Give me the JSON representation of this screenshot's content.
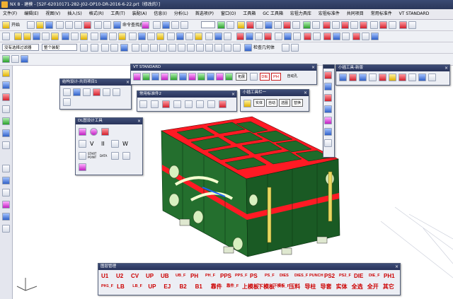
{
  "window": {
    "title": "NX 8 - 建模 - [S2F-62010171-282-J02-OP10-DR-2016-6-22.prt（修改的）]"
  },
  "menu": [
    "文件(F)",
    "编辑(E)",
    "视图(V)",
    "插入(S)",
    "格式(R)",
    "工具(T)",
    "装配(A)",
    "信息(I)",
    "分析(L)",
    "首选项(P)",
    "窗口(O)",
    "工具箱",
    "GC 工具箱",
    "宏祖力具库",
    "宏祖标准件",
    "共同项目",
    "常用标准件",
    "VT STANDARD"
  ],
  "toolbar1": {
    "start_label": "开始",
    "command_finder": "命令查找器"
  },
  "toolbar3": {
    "filter": "没有选择过滤器",
    "assembly_scope": "整个装配"
  },
  "toolbar_r": {
    "label": "检查几何体"
  },
  "panels": {
    "jiegou": {
      "title": "结构设计-共同项目1"
    },
    "vt": {
      "title": "VT STANDARD",
      "buttons": [
        "拓展",
        "DIE",
        "PH",
        "自动孔"
      ]
    },
    "changyong": {
      "title": "常用标准件2"
    },
    "xiaogong1": {
      "title": "小插工具栏一",
      "buttons": [
        "实体",
        "自动",
        "选图",
        "替换"
      ]
    },
    "xiaogong2": {
      "title": "小插工具-新版"
    },
    "dl": {
      "title": "DL图设计工具",
      "row2": [
        "V",
        "II",
        "W"
      ],
      "row3": [
        "START POINT",
        "DATA"
      ]
    },
    "tuceng": {
      "title": "图层管理",
      "row1": [
        "U1",
        "U2",
        "CV",
        "UP",
        "UB",
        "UB_F",
        "PH",
        "PH_F",
        "PPS",
        "PPS_F",
        "PS",
        "PS_F",
        "DIES",
        "DIES_F",
        "PUNCH",
        "PS2",
        "PS2_F",
        "DIE",
        "DIE_F",
        "PH1"
      ],
      "row2": [
        "PH1_F",
        "LB",
        "LB_F",
        "UP",
        "EJ",
        "B2",
        "B1",
        "靠件",
        "靠件_F",
        "上模板",
        "下模板",
        "下模板_F",
        "压料",
        "导柱",
        "导套",
        "实体",
        "全选",
        "全开",
        "其它"
      ]
    }
  },
  "colors": {
    "die_green": "#1f6b2a",
    "die_red": "#ff1a24",
    "title_blue": "#2a375a"
  }
}
